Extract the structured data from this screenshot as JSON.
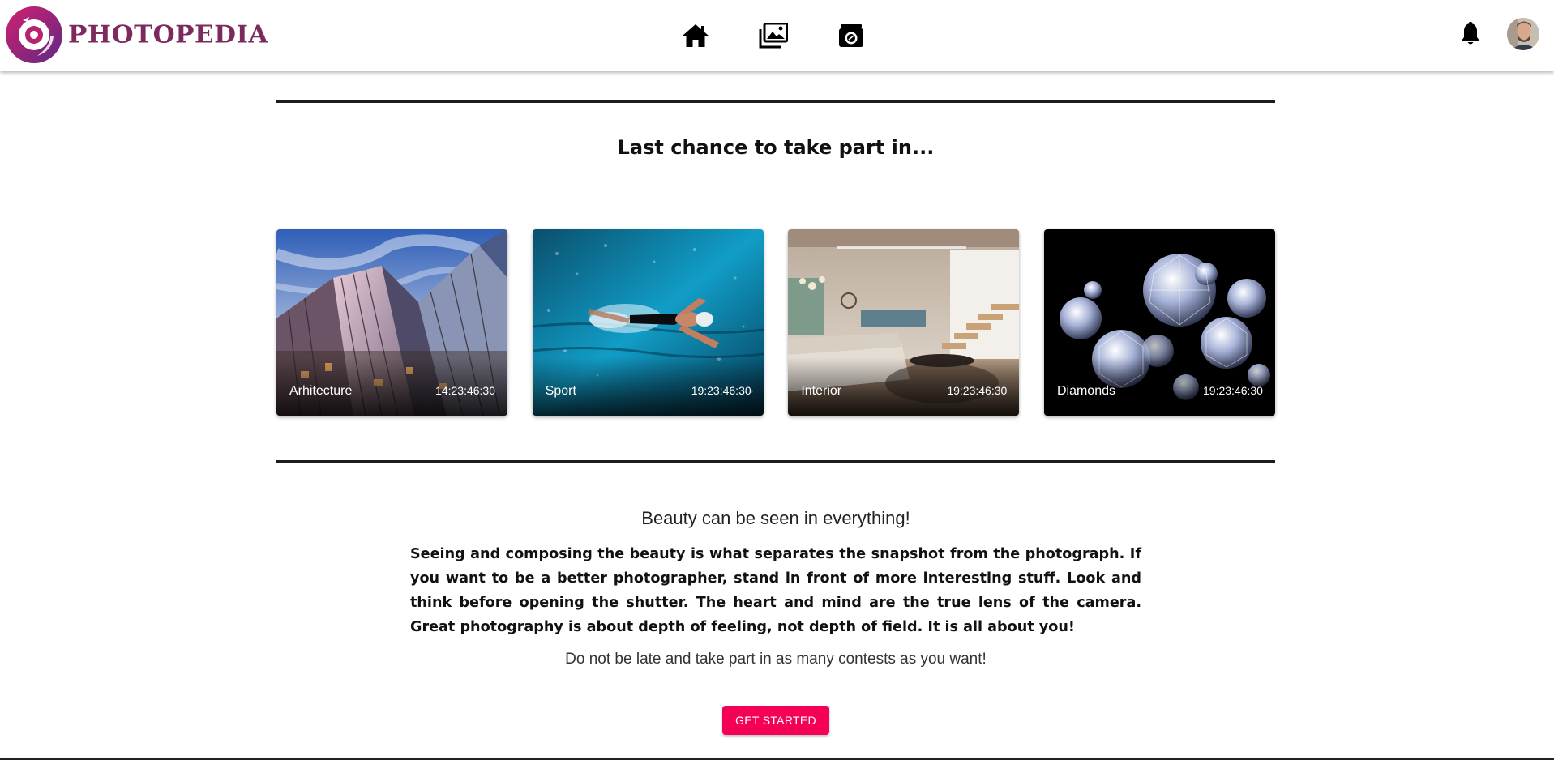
{
  "brand": {
    "name": "PHOTOPEDIA",
    "icon": "camera-lens-logo",
    "color": "#7c2a5e"
  },
  "nav": [
    {
      "id": "home",
      "icon": "home-icon"
    },
    {
      "id": "gallery",
      "icon": "photo-library-icon"
    },
    {
      "id": "contests",
      "icon": "camera-enhance-icon"
    }
  ],
  "toolbar": {
    "notifications_icon": "bell-icon",
    "avatar_icon": "user-avatar"
  },
  "contests_section": {
    "title": "Last chance to take part in...",
    "cards": [
      {
        "title": "Arhitecture",
        "time_left": "14:23:46:30",
        "image": "modern-architecture-glass-facade"
      },
      {
        "title": "Sport",
        "time_left": "19:23:46:30",
        "image": "swimmer-in-pool"
      },
      {
        "title": "Interior",
        "time_left": "19:23:46:30",
        "image": "modern-living-room-interior"
      },
      {
        "title": "Diamonds",
        "time_left": "19:23:46:30",
        "image": "diamonds-on-black"
      }
    ]
  },
  "intro": {
    "heading": "Beauty can be seen in everything!",
    "body": "Seeing and composing the beauty is what separates the snapshot from the photograph. If you want to be a better photographer, stand in front of more interesting stuff. Look and think before opening the shutter. The heart and mind are the true lens of the camera. Great photography is about depth of feeling, not depth of field. It is all about you!",
    "subtext": "Do not be late and take part in as many contests as you want!",
    "cta_label": "GET STARTED"
  },
  "colors": {
    "accent": "#f50057",
    "divider": "#1c1c1c",
    "text": "#111111"
  }
}
